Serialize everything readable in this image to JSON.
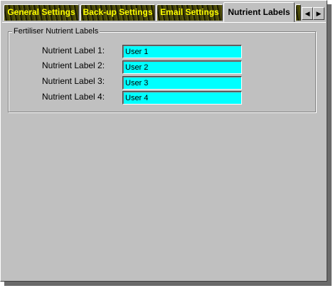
{
  "tabs": [
    {
      "label": "General Settings",
      "active": false
    },
    {
      "label": "Back-up Settings",
      "active": false
    },
    {
      "label": "Email Settings",
      "active": false
    },
    {
      "label": "Nutrient Labels",
      "active": true
    }
  ],
  "tab_scroll": {
    "left_icon": "triangle-left",
    "right_icon": "triangle-right"
  },
  "group": {
    "title": "Fertiliser Nutrient Labels",
    "rows": [
      {
        "label": "Nutrient Label 1:",
        "value": "User 1"
      },
      {
        "label": "Nutrient Label 2:",
        "value": "User 2"
      },
      {
        "label": "Nutrient Label 3:",
        "value": "User 3"
      },
      {
        "label": "Nutrient Label 4:",
        "value": "User 4"
      }
    ]
  },
  "colors": {
    "field_background": "#00ffff",
    "tab_text": "#ffff00",
    "dialog_background": "#c0c0c0"
  }
}
